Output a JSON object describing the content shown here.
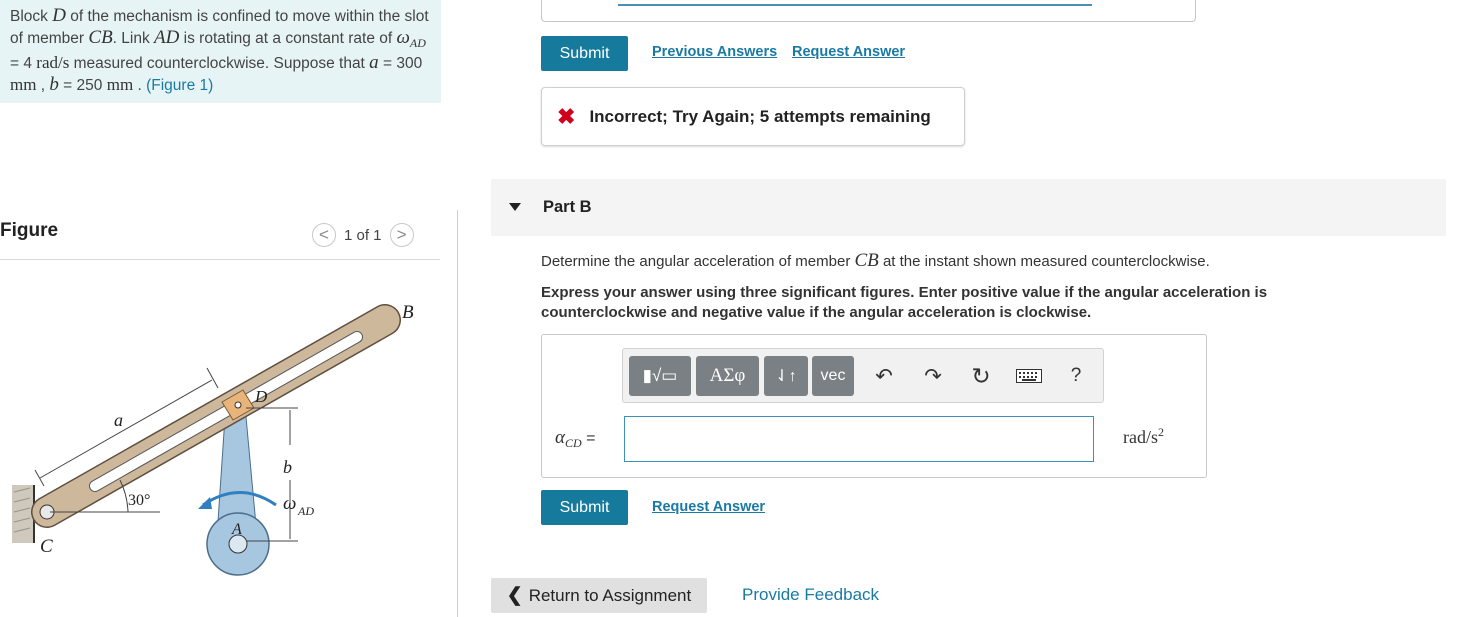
{
  "problem": {
    "t1": "Block ",
    "block": "D",
    "t2": " of the mechanism is confined to move within the slot of member ",
    "member": "CB",
    "t3": ". Link ",
    "link": "AD",
    "t4": " is rotating at a constant rate of ",
    "omega_sym": "ω",
    "omega_sub": "AD",
    "omega_value": " = 4 ",
    "omega_units": "rad/s",
    "t5": " measured counterclockwise. Suppose that ",
    "a_sym": "a",
    "a_value": " = 300 ",
    "a_units": "mm",
    "t6": " , ",
    "b_sym": "b",
    "b_value": " = 250 ",
    "b_units": "mm",
    "t7": " . ",
    "figure_link": "(Figure 1)"
  },
  "figure": {
    "title": "Figure",
    "prev": "<",
    "next": ">",
    "counter": "1 of 1",
    "labels": {
      "B": "B",
      "D": "D",
      "a": "a",
      "b": "b",
      "angle": "30°",
      "omega": "ω",
      "omega_sub": "AD",
      "A": "A",
      "C": "C"
    }
  },
  "part_a": {
    "submit": "Submit",
    "previous_answers": "Previous Answers",
    "request_answer": "Request Answer",
    "feedback_icon": "x-icon",
    "feedback": "Incorrect; Try Again; 5 attempts remaining"
  },
  "part_b": {
    "title": "Part B",
    "q1": "Determine the angular acceleration of member ",
    "q_member": "CB",
    "q2": " at the instant shown measured counterclockwise.",
    "instruction": "Express your answer using three significant figures. Enter positive value if the angular acceleration is counterclockwise and negative value if the angular acceleration is clockwise.",
    "toolbar": {
      "templates": "▮√▭",
      "greek": "ΑΣφ",
      "sort": "⇃↑",
      "vec": "vec",
      "undo": "↶",
      "redo": "↷",
      "reset": "↻",
      "help": "?"
    },
    "variable": "α",
    "variable_sub": "CD",
    "equals": " =",
    "input_value": "",
    "unit": "rad/s",
    "unit_exp": "2",
    "submit": "Submit",
    "request_answer": "Request Answer"
  },
  "footer": {
    "return": "Return to Assignment",
    "feedback": "Provide Feedback"
  },
  "colors": {
    "accent": "#167a9c",
    "link": "#1a7aa3",
    "incorrect": "#d0021b",
    "problem_bg": "#e7f4f6"
  }
}
